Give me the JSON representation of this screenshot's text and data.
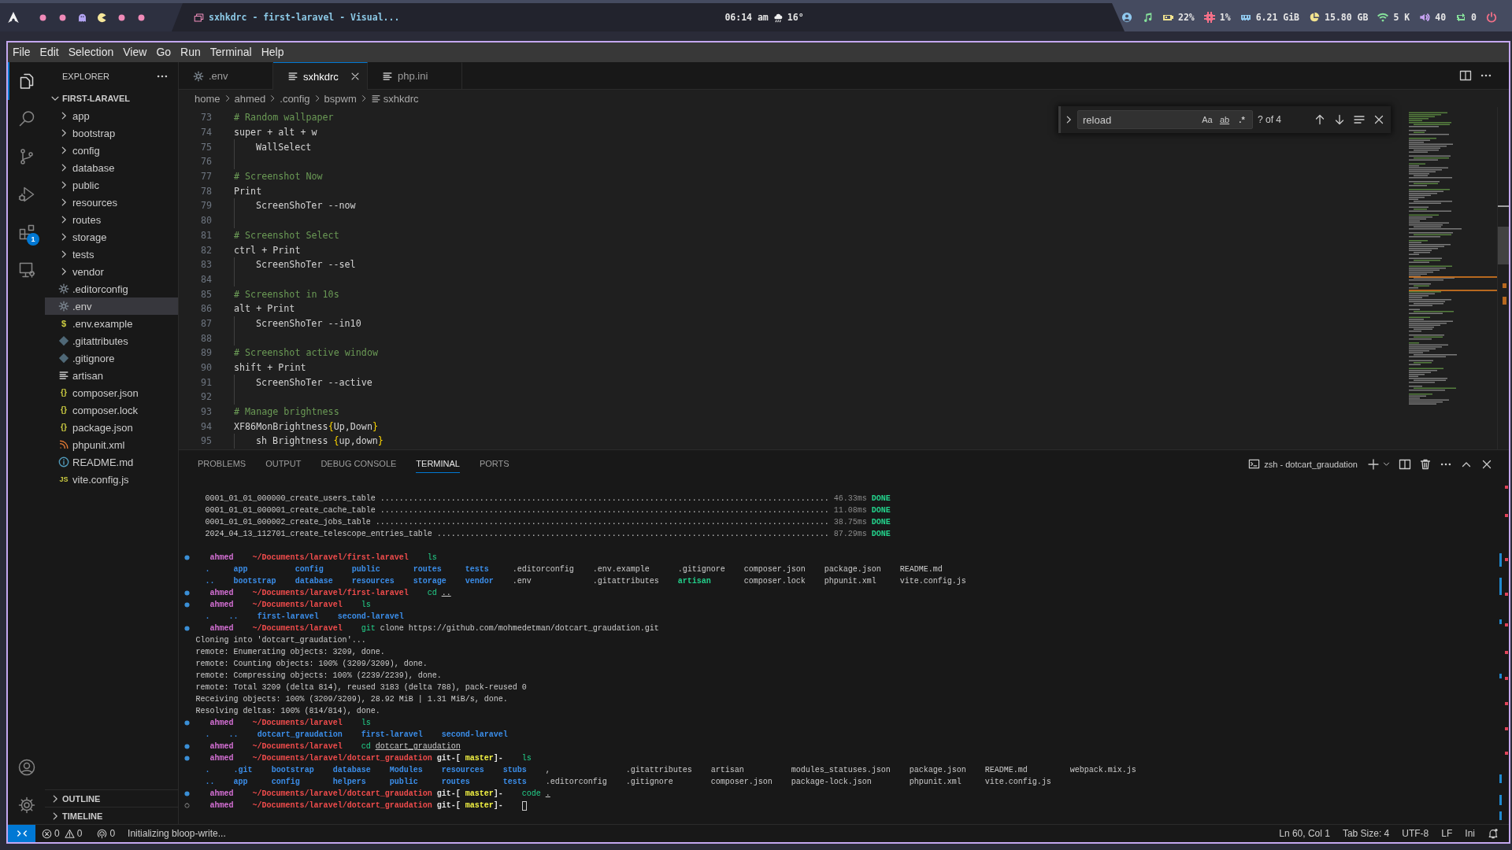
{
  "topbar": {
    "workspaces": [
      {
        "kind": "dot"
      },
      {
        "kind": "dot"
      },
      {
        "kind": "ghost"
      },
      {
        "kind": "pacman"
      },
      {
        "kind": "dot"
      },
      {
        "kind": "dot"
      }
    ],
    "window_title": "sxhkdrc - first-laravel - Visual...",
    "clock": "06:14 am",
    "temperature": "16°",
    "modules": [
      {
        "kind": "user",
        "color": "#8fc8ee"
      },
      {
        "kind": "music",
        "color": "#86e29b"
      },
      {
        "kind": "battery",
        "text": "22%",
        "color": "#f2e38f"
      },
      {
        "kind": "cpu",
        "text": "1%",
        "color": "#f47088"
      },
      {
        "kind": "memory",
        "text": "6.21 GiB",
        "color": "#8fc8ee"
      },
      {
        "kind": "disk",
        "text": "15.80 GB",
        "color": "#f2e38f"
      },
      {
        "kind": "wifi",
        "text": "5 K",
        "color": "#86e29b"
      },
      {
        "kind": "volume",
        "text": "40",
        "color": "#c7a3f2"
      },
      {
        "kind": "updates",
        "text": "0",
        "color": "#86e29b"
      },
      {
        "kind": "power",
        "color": "#f47088"
      }
    ]
  },
  "menu": [
    "File",
    "Edit",
    "Selection",
    "View",
    "Go",
    "Run",
    "Terminal",
    "Help"
  ],
  "activity_bar": {
    "items": [
      {
        "kind": "explorer",
        "selected": true
      },
      {
        "kind": "search",
        "selected": false
      },
      {
        "kind": "source-control",
        "selected": false
      },
      {
        "kind": "run-debug",
        "selected": false
      },
      {
        "kind": "extensions",
        "selected": false,
        "badge": "1"
      },
      {
        "kind": "remote-explorer",
        "selected": false
      }
    ],
    "bottom": [
      {
        "kind": "account"
      },
      {
        "kind": "manage"
      }
    ]
  },
  "sidebar": {
    "title": "EXPLORER",
    "folder": {
      "name": "FIRST-LARAVEL",
      "expanded": true,
      "children": [
        {
          "name": "app",
          "kind": "folder",
          "expanded": false,
          "selected": false
        },
        {
          "name": "bootstrap",
          "kind": "folder",
          "expanded": false,
          "selected": false
        },
        {
          "name": "config",
          "kind": "folder",
          "expanded": false,
          "selected": false
        },
        {
          "name": "database",
          "kind": "folder",
          "expanded": false,
          "selected": false
        },
        {
          "name": "public",
          "kind": "folder",
          "expanded": false,
          "selected": false
        },
        {
          "name": "resources",
          "kind": "folder",
          "expanded": false,
          "selected": false
        },
        {
          "name": "routes",
          "kind": "folder",
          "expanded": false,
          "selected": false
        },
        {
          "name": "storage",
          "kind": "folder",
          "expanded": false,
          "selected": false
        },
        {
          "name": "tests",
          "kind": "folder",
          "expanded": false,
          "selected": false
        },
        {
          "name": "vendor",
          "kind": "folder",
          "expanded": false,
          "selected": false
        },
        {
          "name": ".editorconfig",
          "kind": "settings",
          "selected": false
        },
        {
          "name": ".env",
          "kind": "settings",
          "selected": true
        },
        {
          "name": ".env.example",
          "kind": "shell",
          "glyph": "$",
          "selected": false
        },
        {
          "name": ".gitattributes",
          "kind": "git",
          "selected": false
        },
        {
          "name": ".gitignore",
          "kind": "git",
          "selected": false
        },
        {
          "name": "artisan",
          "kind": "text",
          "selected": false
        },
        {
          "name": "composer.json",
          "kind": "json",
          "glyph": "{}",
          "selected": false
        },
        {
          "name": "composer.lock",
          "kind": "json",
          "glyph": "{}",
          "selected": false
        },
        {
          "name": "package.json",
          "kind": "json",
          "glyph": "{}",
          "selected": false
        },
        {
          "name": "phpunit.xml",
          "kind": "xml",
          "selected": false
        },
        {
          "name": "README.md",
          "kind": "readme",
          "selected": false
        },
        {
          "name": "vite.config.js",
          "kind": "script",
          "glyph": "JS",
          "selected": false
        }
      ]
    },
    "sections": [
      {
        "title": "OUTLINE",
        "expanded": false
      },
      {
        "title": "TIMELINE",
        "expanded": false
      }
    ]
  },
  "editor": {
    "tabs": [
      {
        "label": ".env",
        "kind": "settings",
        "selected": false
      },
      {
        "label": "sxhkdrc",
        "kind": "text",
        "selected": true
      },
      {
        "label": "php.ini",
        "kind": "text",
        "selected": false
      }
    ],
    "breadcrumb": [
      "home",
      "ahmed",
      ".config",
      "bspwm",
      "sxhkdrc"
    ],
    "lines": [
      {
        "number": "73",
        "indented": false,
        "tokens": [
          {
            "text": "# Random wallpaper",
            "kind": "comment"
          }
        ]
      },
      {
        "number": "74",
        "indented": false,
        "tokens": [
          {
            "text": "super + alt + w",
            "kind": "plain"
          }
        ]
      },
      {
        "number": "75",
        "indented": true,
        "tokens": [
          {
            "text": "WallSelect",
            "kind": "plain"
          }
        ]
      },
      {
        "number": "76",
        "indented": true
      },
      {
        "number": "77",
        "indented": false,
        "tokens": [
          {
            "text": "# Screenshot Now",
            "kind": "comment"
          }
        ]
      },
      {
        "number": "78",
        "indented": false,
        "tokens": [
          {
            "text": "Print",
            "kind": "plain"
          }
        ]
      },
      {
        "number": "79",
        "indented": true,
        "tokens": [
          {
            "text": "ScreenShoTer --now",
            "kind": "plain"
          }
        ]
      },
      {
        "number": "80",
        "indented": true
      },
      {
        "number": "81",
        "indented": false,
        "tokens": [
          {
            "text": "# Screenshot Select",
            "kind": "comment"
          }
        ]
      },
      {
        "number": "82",
        "indented": false,
        "tokens": [
          {
            "text": "ctrl + Print",
            "kind": "plain"
          }
        ]
      },
      {
        "number": "83",
        "indented": true,
        "tokens": [
          {
            "text": "ScreenShoTer --sel",
            "kind": "plain"
          }
        ]
      },
      {
        "number": "84",
        "indented": true
      },
      {
        "number": "85",
        "indented": false,
        "tokens": [
          {
            "text": "# Screenshot in 10s",
            "kind": "comment"
          }
        ]
      },
      {
        "number": "86",
        "indented": false,
        "tokens": [
          {
            "text": "alt + Print",
            "kind": "plain"
          }
        ]
      },
      {
        "number": "87",
        "indented": true,
        "tokens": [
          {
            "text": "ScreenShoTer --in10",
            "kind": "plain"
          }
        ]
      },
      {
        "number": "88",
        "indented": true
      },
      {
        "number": "89",
        "indented": false,
        "tokens": [
          {
            "text": "# Screenshot active window",
            "kind": "comment"
          }
        ]
      },
      {
        "number": "90",
        "indented": false,
        "tokens": [
          {
            "text": "shift + Print",
            "kind": "plain"
          }
        ]
      },
      {
        "number": "91",
        "indented": true,
        "tokens": [
          {
            "text": "ScreenShoTer --active",
            "kind": "plain"
          }
        ]
      },
      {
        "number": "92",
        "indented": true
      },
      {
        "number": "93",
        "indented": false,
        "tokens": [
          {
            "text": "# Manage brightness",
            "kind": "comment"
          }
        ]
      },
      {
        "number": "94",
        "indented": false,
        "tokens": [
          {
            "text": "XF86MonBrightness",
            "kind": "plain"
          },
          {
            "text": "{",
            "kind": "bracket"
          },
          {
            "text": "Up,Down",
            "kind": "plain"
          },
          {
            "text": "}",
            "kind": "bracket"
          }
        ]
      },
      {
        "number": "95",
        "indented": true,
        "tokens": [
          {
            "text": "sh Brightness ",
            "kind": "plain"
          },
          {
            "text": "{",
            "kind": "bracket"
          },
          {
            "text": "up,down",
            "kind": "plain"
          },
          {
            "text": "}",
            "kind": "bracket"
          }
        ]
      }
    ],
    "find": {
      "value": "reload",
      "options": [
        {
          "kind": "case",
          "label": "Aa",
          "selected": false
        },
        {
          "kind": "word",
          "label": "ab",
          "selected": false
        },
        {
          "kind": "regex",
          "label": ".*",
          "selected": false
        }
      ],
      "count": "? of 4"
    }
  },
  "panel": {
    "tabs": [
      {
        "label": "PROBLEMS",
        "selected": false
      },
      {
        "label": "OUTPUT",
        "selected": false
      },
      {
        "label": "DEBUG CONSOLE",
        "selected": false
      },
      {
        "label": "TERMINAL",
        "selected": true
      },
      {
        "label": "PORTS",
        "selected": false
      }
    ],
    "terminal_title": "zsh - dotcart_graudation",
    "lines": [
      {
        "kind": "migration",
        "segments": [
          {
            "text": "0001_01_01_000000_create_users_table ...............................................................................................",
            "kind": "plain"
          },
          {
            "text": "46.33ms",
            "kind": "timing"
          },
          {
            "text": "DONE",
            "kind": "done"
          }
        ]
      },
      {
        "kind": "migration",
        "segments": [
          {
            "text": "0001_01_01_000001_create_cache_table ...............................................................................................",
            "kind": "plain"
          },
          {
            "text": "11.08ms",
            "kind": "timing"
          },
          {
            "text": "DONE",
            "kind": "done"
          }
        ]
      },
      {
        "kind": "migration",
        "segments": [
          {
            "text": "0001_01_01_000002_create_jobs_table ................................................................................................",
            "kind": "plain"
          },
          {
            "text": "38.75ms",
            "kind": "timing"
          },
          {
            "text": "DONE",
            "kind": "done"
          }
        ]
      },
      {
        "kind": "migration",
        "segments": [
          {
            "text": "2024_04_13_112701_create_telescope_entries_table ...................................................................................",
            "kind": "plain"
          },
          {
            "text": "87.29ms",
            "kind": "timing"
          },
          {
            "text": "DONE",
            "kind": "done"
          }
        ]
      },
      {
        "kind": "blank"
      },
      {
        "kind": "prompt",
        "completed": true,
        "segments": [
          {
            "text": "ahmed",
            "kind": "user"
          },
          {
            "text": "~/Documents/laravel/first-laravel",
            "kind": "path"
          },
          {
            "text": "ls",
            "kind": "command"
          }
        ]
      },
      {
        "kind": "listing",
        "rows": [
          [
            {
              "name": ".",
              "kind": "dir"
            },
            {
              "name": "app",
              "kind": "dir"
            },
            {
              "name": "config",
              "kind": "dir"
            },
            {
              "name": "public",
              "kind": "dir"
            },
            {
              "name": "routes",
              "kind": "dir"
            },
            {
              "name": "tests",
              "kind": "dir"
            },
            {
              "name": ".editorconfig",
              "kind": "file"
            },
            {
              "name": ".env.example",
              "kind": "file"
            },
            {
              "name": ".gitignore",
              "kind": "file"
            },
            {
              "name": "composer.json",
              "kind": "file"
            },
            {
              "name": "package.json",
              "kind": "file"
            },
            {
              "name": "README.md",
              "kind": "file"
            }
          ],
          [
            {
              "name": "..",
              "kind": "dir"
            },
            {
              "name": "bootstrap",
              "kind": "dir"
            },
            {
              "name": "database",
              "kind": "dir"
            },
            {
              "name": "resources",
              "kind": "dir"
            },
            {
              "name": "storage",
              "kind": "dir"
            },
            {
              "name": "vendor",
              "kind": "dir"
            },
            {
              "name": ".env",
              "kind": "file"
            },
            {
              "name": ".gitattributes",
              "kind": "file"
            },
            {
              "name": "artisan",
              "kind": "exec"
            },
            {
              "name": "composer.lock",
              "kind": "file"
            },
            {
              "name": "phpunit.xml",
              "kind": "file"
            },
            {
              "name": "vite.config.js",
              "kind": "file"
            }
          ]
        ]
      },
      {
        "kind": "prompt",
        "completed": true,
        "segments": [
          {
            "text": "ahmed",
            "kind": "user"
          },
          {
            "text": "~/Documents/laravel/first-laravel",
            "kind": "path"
          },
          {
            "text": "cd",
            "kind": "command"
          },
          {
            "text": "..",
            "kind": "link"
          }
        ]
      },
      {
        "kind": "prompt",
        "completed": true,
        "segments": [
          {
            "text": "ahmed",
            "kind": "user"
          },
          {
            "text": "~/Documents/laravel",
            "kind": "path"
          },
          {
            "text": "ls",
            "kind": "command"
          }
        ]
      },
      {
        "kind": "listing",
        "rows": [
          [
            {
              "name": ".",
              "kind": "dir"
            },
            {
              "name": "..",
              "kind": "dir"
            },
            {
              "name": "first-laravel",
              "kind": "dir"
            },
            {
              "name": "second-laravel",
              "kind": "dir"
            }
          ]
        ]
      },
      {
        "kind": "prompt",
        "completed": true,
        "segments": [
          {
            "text": "ahmed",
            "kind": "user"
          },
          {
            "text": "~/Documents/laravel",
            "kind": "path"
          },
          {
            "text": "git",
            "kind": "command"
          },
          {
            "text": "clone https://github.com/mohmedetman/dotcart_graudation.git",
            "kind": "arg"
          }
        ]
      },
      {
        "kind": "output",
        "text": "Cloning into 'dotcart_graudation'..."
      },
      {
        "kind": "output",
        "text": "remote: Enumerating objects: 3209, done."
      },
      {
        "kind": "output",
        "text": "remote: Counting objects: 100% (3209/3209), done."
      },
      {
        "kind": "output",
        "text": "remote: Compressing objects: 100% (2239/2239), done."
      },
      {
        "kind": "output",
        "text": "remote: Total 3209 (delta 814), reused 3183 (delta 788), pack-reused 0"
      },
      {
        "kind": "output",
        "text": "Receiving objects: 100% (3209/3209), 28.92 MiB | 1.31 MiB/s, done."
      },
      {
        "kind": "output",
        "text": "Resolving deltas: 100% (814/814), done."
      },
      {
        "kind": "prompt",
        "completed": true,
        "segments": [
          {
            "text": "ahmed",
            "kind": "user"
          },
          {
            "text": "~/Documents/laravel",
            "kind": "path"
          },
          {
            "text": "ls",
            "kind": "command"
          }
        ]
      },
      {
        "kind": "listing",
        "rows": [
          [
            {
              "name": ".",
              "kind": "dir"
            },
            {
              "name": "..",
              "kind": "dir"
            },
            {
              "name": "dotcart_graudation",
              "kind": "dir"
            },
            {
              "name": "first-laravel",
              "kind": "dir"
            },
            {
              "name": "second-laravel",
              "kind": "dir"
            }
          ]
        ]
      },
      {
        "kind": "prompt",
        "completed": true,
        "segments": [
          {
            "text": "ahmed",
            "kind": "user"
          },
          {
            "text": "~/Documents/laravel",
            "kind": "path"
          },
          {
            "text": "cd",
            "kind": "command"
          },
          {
            "text": "dotcart_graudation",
            "kind": "link"
          }
        ]
      },
      {
        "kind": "prompt",
        "completed": true,
        "segments": [
          {
            "text": "ahmed",
            "kind": "user"
          },
          {
            "text": "~/Documents/laravel/dotcart_graudation",
            "kind": "path"
          },
          {
            "text": "git-[",
            "kind": "git"
          },
          {
            "text": "master",
            "kind": "branch"
          },
          {
            "text": "]-",
            "kind": "git-close"
          },
          {
            "text": "ls",
            "kind": "command"
          }
        ]
      },
      {
        "kind": "listing",
        "rows": [
          [
            {
              "name": ".",
              "kind": "dir"
            },
            {
              "name": ".git",
              "kind": "dir"
            },
            {
              "name": "bootstrap",
              "kind": "dir"
            },
            {
              "name": "database",
              "kind": "dir"
            },
            {
              "name": "Modules",
              "kind": "dir"
            },
            {
              "name": "resources",
              "kind": "dir"
            },
            {
              "name": "stubs",
              "kind": "dir"
            },
            {
              "name": ",",
              "kind": "file"
            },
            {
              "name": ".gitattributes",
              "kind": "file"
            },
            {
              "name": "artisan",
              "kind": "file"
            },
            {
              "name": "modules_statuses.json",
              "kind": "file"
            },
            {
              "name": "package.json",
              "kind": "file"
            },
            {
              "name": "README.md",
              "kind": "file"
            },
            {
              "name": "webpack.mix.js",
              "kind": "file"
            }
          ],
          [
            {
              "name": "..",
              "kind": "dir"
            },
            {
              "name": "app",
              "kind": "dir"
            },
            {
              "name": "config",
              "kind": "dir"
            },
            {
              "name": "helpers",
              "kind": "dir"
            },
            {
              "name": "public",
              "kind": "dir"
            },
            {
              "name": "routes",
              "kind": "dir"
            },
            {
              "name": "tests",
              "kind": "dir"
            },
            {
              "name": ".editorconfig",
              "kind": "file"
            },
            {
              "name": ".gitignore",
              "kind": "file"
            },
            {
              "name": "composer.json",
              "kind": "file"
            },
            {
              "name": "package-lock.json",
              "kind": "file"
            },
            {
              "name": "phpunit.xml",
              "kind": "file"
            },
            {
              "name": "vite.config.js",
              "kind": "file"
            }
          ]
        ]
      },
      {
        "kind": "prompt",
        "completed": true,
        "segments": [
          {
            "text": "ahmed",
            "kind": "user"
          },
          {
            "text": "~/Documents/laravel/dotcart_graudation",
            "kind": "path"
          },
          {
            "text": "git-[",
            "kind": "git"
          },
          {
            "text": "master",
            "kind": "branch"
          },
          {
            "text": "]-",
            "kind": "git-close"
          },
          {
            "text": "code",
            "kind": "command"
          },
          {
            "text": ".",
            "kind": "link"
          }
        ]
      },
      {
        "kind": "prompt",
        "completed": false,
        "cursor": true,
        "segments": [
          {
            "text": "ahmed",
            "kind": "user"
          },
          {
            "text": "~/Documents/laravel/dotcart_graudation",
            "kind": "path"
          },
          {
            "text": "git-[",
            "kind": "git"
          },
          {
            "text": "master",
            "kind": "branch"
          },
          {
            "text": "]-",
            "kind": "git-close"
          }
        ]
      }
    ]
  },
  "status_bar": {
    "problems": [
      {
        "kind": "error",
        "count": "0"
      },
      {
        "kind": "warning",
        "count": "0"
      }
    ],
    "ports": "0",
    "message": "Initializing bloop-write...",
    "items": [
      "Ln 60, Col 1",
      "Tab Size: 4",
      "UTF-8",
      "LF",
      "Ini"
    ]
  }
}
